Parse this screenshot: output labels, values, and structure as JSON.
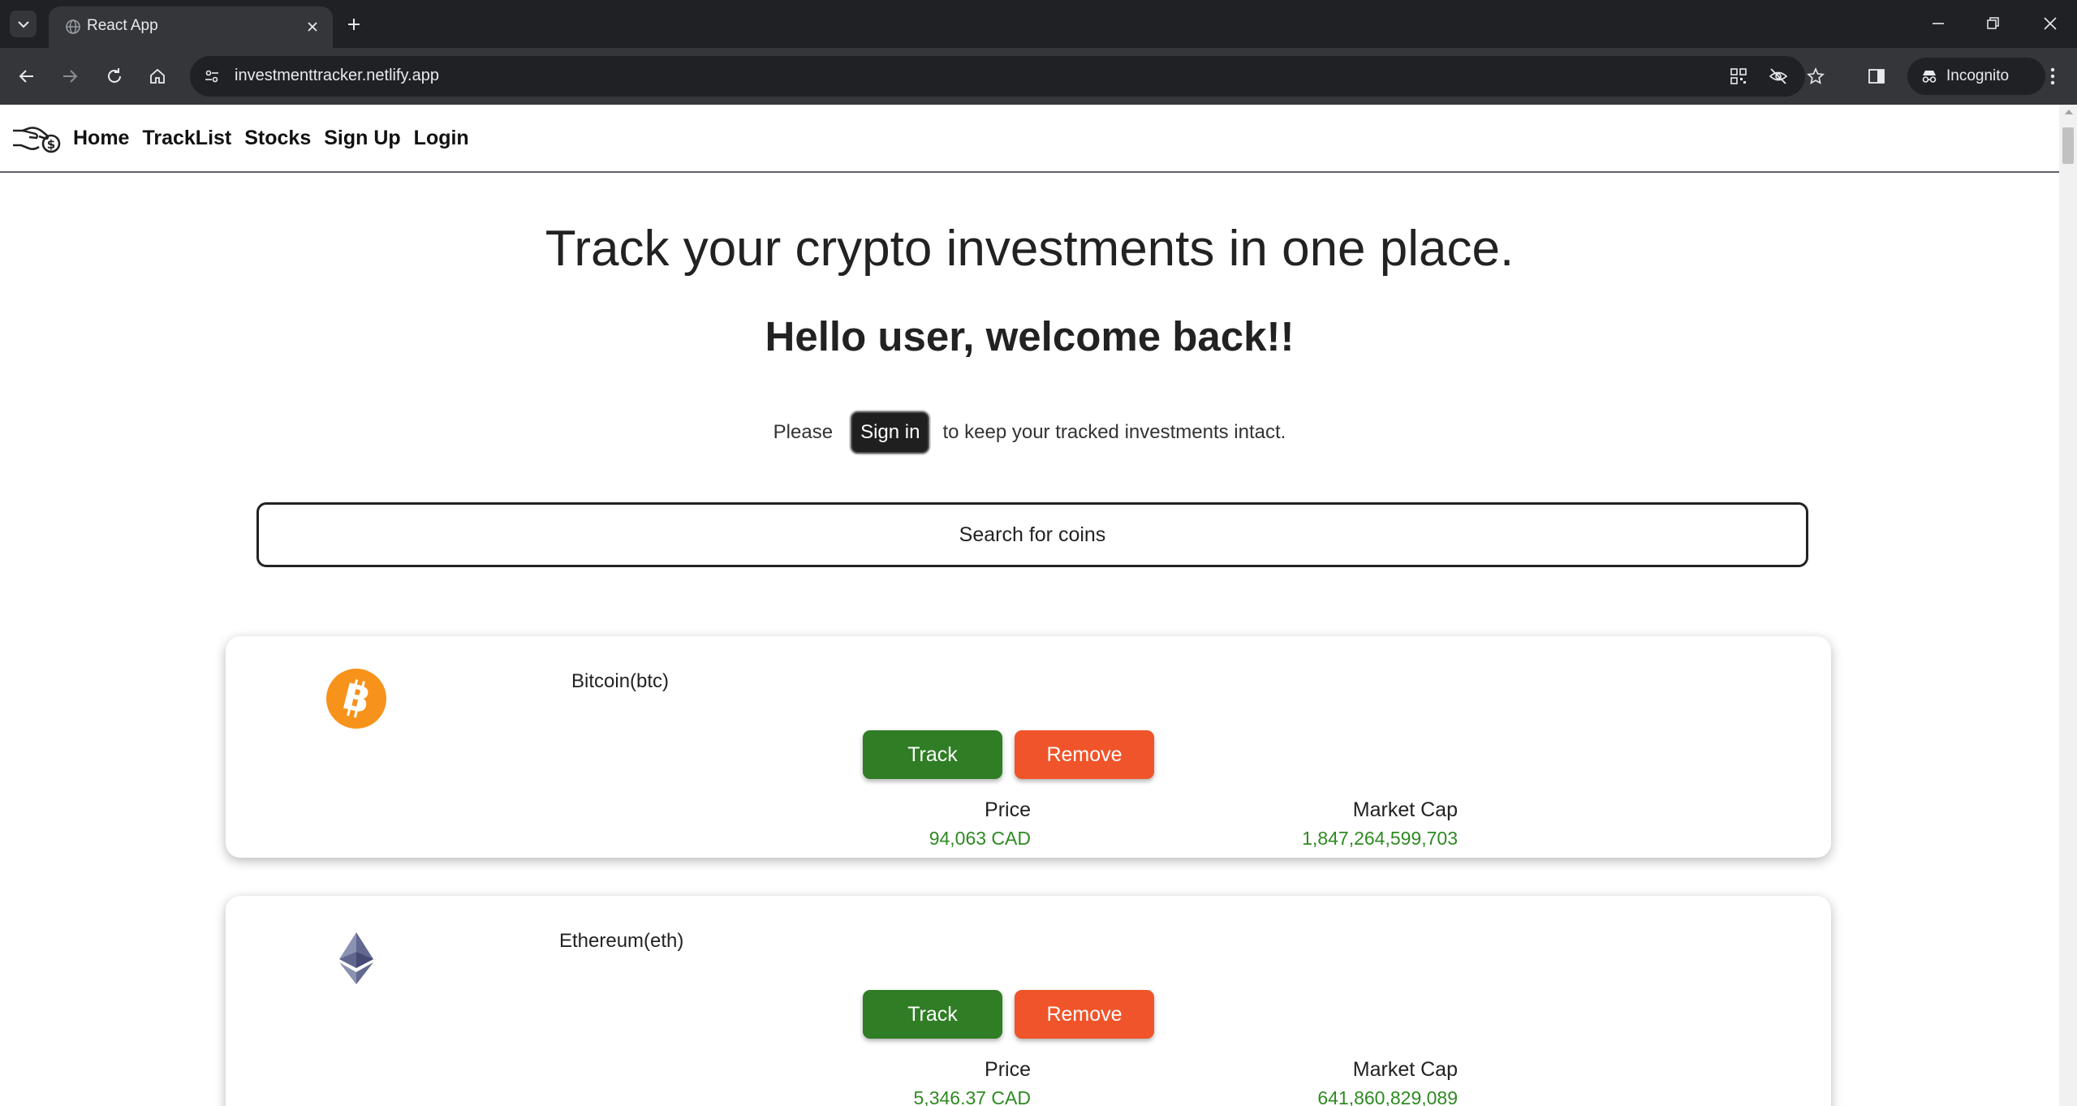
{
  "browser": {
    "tab_title": "React App",
    "url": "investmenttracker.netlify.app",
    "incognito_label": "Incognito"
  },
  "nav": {
    "links": [
      "Home",
      "TrackList",
      "Stocks",
      "Sign Up",
      "Login"
    ]
  },
  "hero": {
    "title": "Track your crypto investments in one place.",
    "welcome": "Hello user, welcome back!!",
    "signin_prefix": "Please",
    "signin_button": "Sign in",
    "signin_suffix": "to keep your tracked investments intact."
  },
  "search": {
    "placeholder": "Search for coins"
  },
  "coins": [
    {
      "name": "Bitcoin(btc)",
      "icon": "bitcoin-icon",
      "track_label": "Track",
      "remove_label": "Remove",
      "price_label": "Price",
      "price": "94,063 CAD",
      "market_cap_label": "Market Cap",
      "market_cap": "1,847,264,599,703"
    },
    {
      "name": "Ethereum(eth)",
      "icon": "ethereum-icon",
      "track_label": "Track",
      "remove_label": "Remove",
      "price_label": "Price",
      "price": "5,346.37 CAD",
      "market_cap_label": "Market Cap",
      "market_cap": "641,860,829,089"
    }
  ],
  "colors": {
    "track": "#2f7d24",
    "remove": "#f0542a",
    "value_green": "#2f8a22",
    "bitcoin": "#f7931a"
  }
}
